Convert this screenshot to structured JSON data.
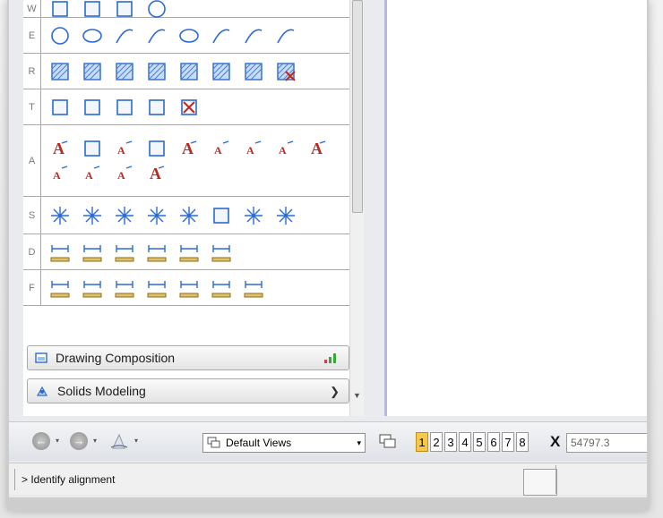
{
  "task_panel": {
    "rows": [
      {
        "letter": "W",
        "icons": [
          "place-block-icon",
          "place-shape-icon",
          "place-smartline-icon",
          "place-circle-arrow-icon"
        ]
      },
      {
        "letter": "E",
        "icons": [
          "place-circle-icon",
          "place-ellipse-icon",
          "place-arc-icon",
          "modify-arc-icon",
          "place-half-ellipse-icon",
          "place-arc-center-icon",
          "place-curve-icon",
          "construct-curve-icon"
        ]
      },
      {
        "letter": "R",
        "icons": [
          "hatch-area-icon",
          "crosshatch-area-icon",
          "pattern-area-icon",
          "linear-pattern-icon",
          "show-pattern-icon",
          "match-pattern-icon",
          "change-pattern-icon",
          "delete-pattern-icon"
        ]
      },
      {
        "letter": "T",
        "icons": [
          "create-region-icon",
          "create-complex-icon",
          "group-holes-icon",
          "analyze-region-icon",
          "drop-complex-icon"
        ]
      },
      {
        "letter": "A",
        "icons": [
          "place-text-icon",
          "place-note-icon",
          "edit-text-icon",
          "spell-check-icon",
          "find-text-icon",
          "text-above-icon",
          "text-along-icon",
          "increment-text-icon",
          "change-text-icon",
          "match-text-icon",
          "display-text-icon",
          "text-node-icon",
          "enter-data-field-icon"
        ]
      },
      {
        "letter": "S",
        "icons": [
          "place-cell-icon",
          "define-cell-icon",
          "select-cell-icon",
          "replace-cell-icon",
          "identify-cell-icon",
          "place-arrow-icon",
          "active-cell-icon",
          "cell-library-icon"
        ]
      },
      {
        "letter": "D",
        "icons": [
          "dimension-element-icon",
          "dimension-arc-icon",
          "dimension-angle-icon",
          "dimension-size-icon",
          "dimension-radius-icon",
          "dimension-3d-icon"
        ]
      },
      {
        "letter": "F",
        "icons": [
          "dimension-linear-icon",
          "dimension-stack-icon",
          "dimension-diagonal-icon",
          "dimension-ordinate-icon",
          "dimension-arrow-icon",
          "dimension-chain-icon",
          "dimension-points-icon"
        ]
      }
    ],
    "drawing_composition_label": "Drawing Composition",
    "solids_modeling_label": "Solids Modeling"
  },
  "toolbar": {
    "back_symbol": "←",
    "forward_symbol": "→",
    "dropdown_symbol": "▾",
    "views_label": "Default Views",
    "view_numbers": [
      "1",
      "2",
      "3",
      "4",
      "5",
      "6",
      "7",
      "8"
    ],
    "active_view": "1",
    "x_label": "X",
    "x_value": "54797.3"
  },
  "statusbar": {
    "prompt": "> Identify alignment"
  },
  "colors": {
    "accent_yellow": "#f7c94b",
    "workspace_border": "#b6b6e6",
    "icon_blue": "#2a6ad3",
    "icon_red": "#c0271d"
  }
}
